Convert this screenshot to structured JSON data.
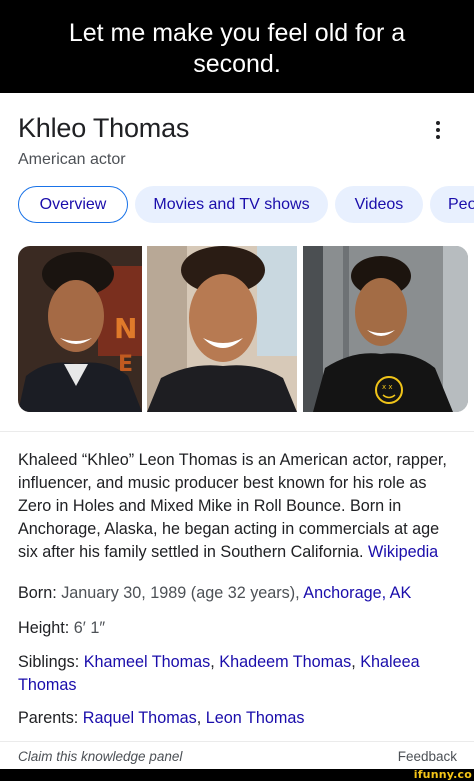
{
  "meme": {
    "caption_line1": "Let me make you feel old for a",
    "caption_line2": "second."
  },
  "panel": {
    "title": "Khleo Thomas",
    "subtitle": "American actor",
    "menu_icon": "more-vert-icon",
    "tabs": [
      {
        "label": "Overview",
        "active": true
      },
      {
        "label": "Movies and TV shows",
        "active": false
      },
      {
        "label": "Videos",
        "active": false
      },
      {
        "label": "Peo",
        "active": false
      }
    ],
    "description": "Khaleed “Khleo” Leon Thomas is an American actor, rapper, influencer, and music producer best known for his role as Zero in Holes and Mixed Mike in Roll Bounce. Born in Anchorage, Alaska, he began acting in commercials at age six after his family settled in Southern California.",
    "description_source": "Wikipedia",
    "facts": {
      "born_label": "Born:",
      "born_value": "January 30, 1989 (age 32 years),",
      "born_place": "Anchorage, AK",
      "height_label": "Height:",
      "height_value": "6′ 1″",
      "siblings_label": "Siblings:",
      "siblings": [
        "Khameel Thomas",
        "Khadeem Thomas",
        "Khaleea Thomas"
      ],
      "parents_label": "Parents:",
      "parents": [
        "Raquel Thomas",
        "Leon Thomas"
      ]
    },
    "footer": {
      "claim": "Claim this knowledge panel",
      "feedback": "Feedback"
    }
  },
  "watermark": "ifunny.co",
  "colors": {
    "link": "#1a0dab",
    "tab_bg": "#e8f0fe",
    "active_tab_border": "#1a73e8",
    "text": "#202124",
    "muted": "#4d5156"
  }
}
